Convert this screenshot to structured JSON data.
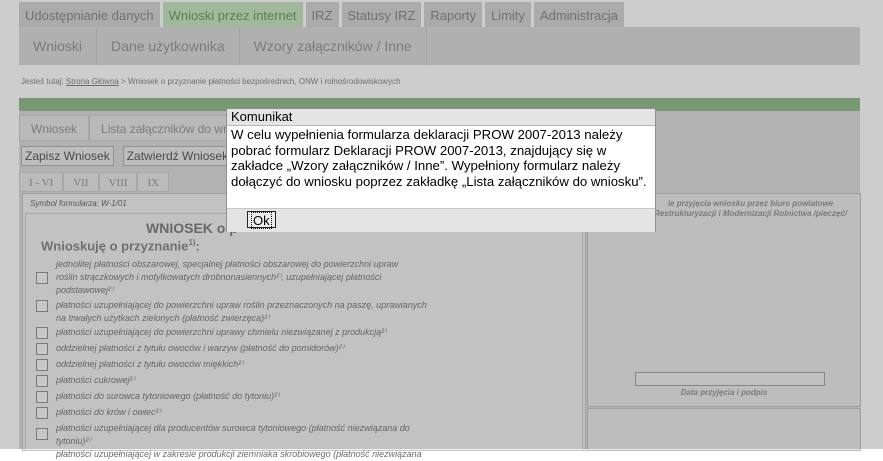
{
  "top_nav": [
    {
      "label": "Udostępnianie danych"
    },
    {
      "label": "Wnioski przez internet",
      "active": true
    },
    {
      "label": "IRZ"
    },
    {
      "label": "Statusy IRZ"
    },
    {
      "label": "Raporty"
    },
    {
      "label": "Limity"
    },
    {
      "label": "Administracja"
    }
  ],
  "sub_nav": [
    {
      "label": "Wnioski"
    },
    {
      "label": "Dane użytkownika"
    },
    {
      "label": "Wzory załączników / Inne"
    }
  ],
  "breadcrumb": {
    "prefix": "Jesteś tutaj: ",
    "home": "Strona Główna",
    "rest": " > Wniosek o przyznanie płatności bezpośrednich, ONW i rolnośrodowiskowych"
  },
  "panel_tabs": [
    {
      "label": "Wniosek"
    },
    {
      "label": "Lista załączników do wnio"
    }
  ],
  "buttons": {
    "save": "Zapisz Wniosek",
    "confirm": "Zatwierdź Wniosek"
  },
  "roman_tabs": [
    "I - VI",
    "VII",
    "VIII",
    "IX"
  ],
  "form": {
    "symbol": "Symbol formularza: W-1/01",
    "title": "WNIOSEK o p",
    "subtitle": "Wnioskuję o przyznanie",
    "subtitle_sup": "1)",
    "items": [
      {
        "lines": [
          "jednolitej płatności obszarowej, specjalnej płatności obszarowej do powierzchni upraw",
          "roślin strączkowych i motylkowatych drobnonasiennych²⁾, uzupełniającej płatności",
          "podstawowej²⁾"
        ]
      },
      {
        "lines": [
          "płatności uzupełniającej do powierzchni upraw roślin przeznaczonych na paszę, uprawianych",
          "na trwałych użytkach zielonych (płatność zwierzęca)²⁾"
        ]
      },
      {
        "lines": [
          "płatności uzupełniającej do powierzchni uprawy chmielu niezwiązanej z produkcją²⁾"
        ]
      },
      {
        "lines": [
          "oddzielnej płatności z tytułu owoców i warzyw (płatność do pomidorów)²⁾"
        ]
      },
      {
        "lines": [
          "oddzielnej płatności z tytułu owoców miękkich²⁾"
        ]
      },
      {
        "lines": [
          "płatności cukrowej²⁾"
        ]
      },
      {
        "lines": [
          "płatności do surowca tytoniowego (płatność do tytoniu)²⁾"
        ]
      },
      {
        "lines": [
          "płatności do krów i owiec²⁾"
        ]
      },
      {
        "lines": [
          "płatności uzupełniającej dla producentów surowca tytoniowego (płatność niezwiązana do",
          "tytoniu)²⁾"
        ]
      },
      {
        "lines": [
          "płatności uzupełniającej w zakresie produkcji ziemniaka skrobiowego (płatność niezwiązana"
        ]
      }
    ]
  },
  "stamp": {
    "text": "ie przyjęcia wniosku przez biuro powiatowe Restrukturyzacji i Modernizacji Rolnictwa /pieczęć/",
    "date_label": "Data przyjęcia i podpis"
  },
  "modal": {
    "title": "Komunikat",
    "message": "W celu wypełnienia formularza deklaracji PROW 2007-2013 należy pobrać formularz Deklaracji PROW 2007-2013, znajdujący się w zakładce „Wzory załączników / Inne”. Wypełniony formularz należy dołączyć do wniosku poprzez zakładkę „Lista załączników do wniosku”.",
    "ok_label": "Ok"
  }
}
